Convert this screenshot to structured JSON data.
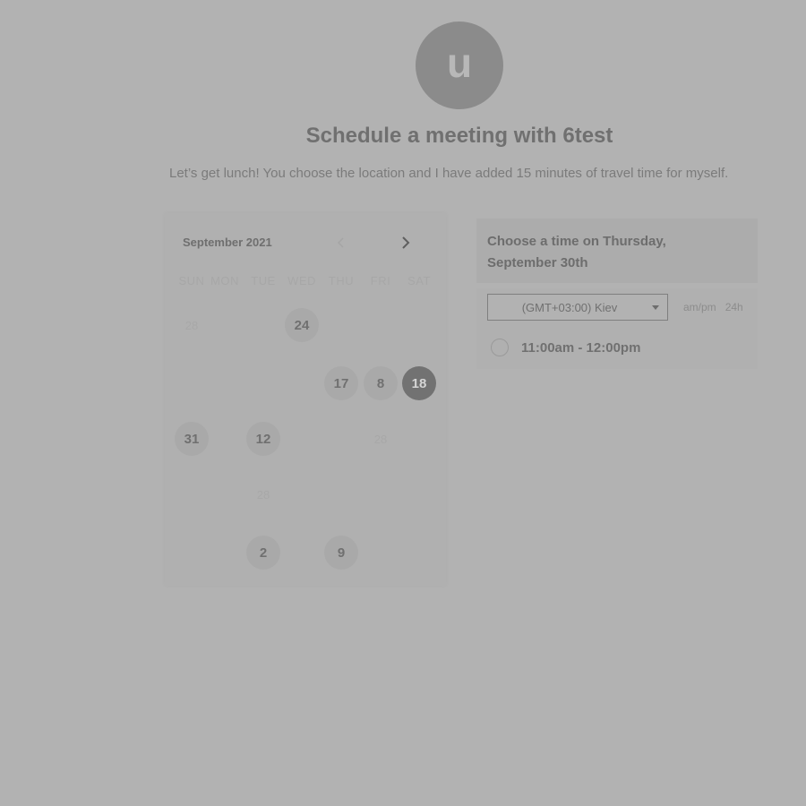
{
  "header": {
    "avatar_letter": "u",
    "title": "Schedule a meeting with 6test",
    "subtitle": "Let’s get lunch! You choose the location and I have added 15 minutes of travel time for myself."
  },
  "calendar": {
    "month": "September 2021",
    "weekdays": [
      "SUN",
      "MON",
      "TUE",
      "WED",
      "THU",
      "FRI",
      "SAT"
    ],
    "days": [
      {
        "label": "28",
        "state": "faded",
        "row": 0,
        "col": 0
      },
      {
        "label": "24",
        "state": "available",
        "row": 0,
        "col": 3
      },
      {
        "label": "17",
        "state": "available",
        "row": 1,
        "col": 4
      },
      {
        "label": "8",
        "state": "available",
        "row": 1,
        "col": 5
      },
      {
        "label": "18",
        "state": "selected",
        "row": 1,
        "col": 6
      },
      {
        "label": "31",
        "state": "available",
        "row": 2,
        "col": 0
      },
      {
        "label": "12",
        "state": "available",
        "row": 2,
        "col": 2
      },
      {
        "label": "28",
        "state": "faded",
        "row": 2,
        "col": 5
      },
      {
        "label": "28",
        "state": "faded",
        "row": 3,
        "col": 2
      },
      {
        "label": "2",
        "state": "available",
        "row": 4,
        "col": 2
      },
      {
        "label": "9",
        "state": "available",
        "row": 4,
        "col": 4
      }
    ]
  },
  "times": {
    "heading": "Choose a time on Thursday, September 30th",
    "timezone": "(GMT+03:00) Kiev",
    "format_12h": "am/pm",
    "format_24h": "24h",
    "slots": [
      "11:00am - 12:00pm"
    ]
  },
  "colors": {
    "background": "#b2b2b2",
    "selected_day": "#727272",
    "available_day": "#a9a9a9",
    "avatar": "#8b8b8b"
  }
}
